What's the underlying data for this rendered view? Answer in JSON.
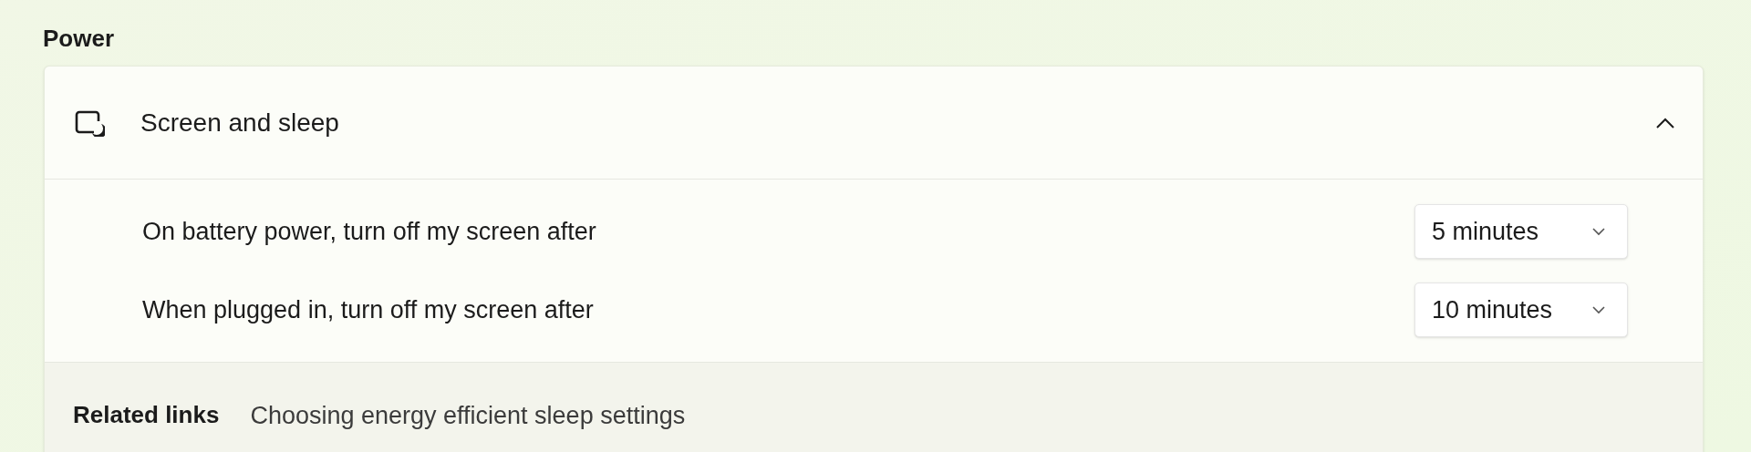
{
  "section_title": "Power",
  "group": {
    "title": "Screen and sleep",
    "expanded": true,
    "settings": [
      {
        "label": "On battery power, turn off my screen after",
        "value": "5 minutes"
      },
      {
        "label": "When plugged in, turn off my screen after",
        "value": "10 minutes"
      }
    ]
  },
  "related": {
    "heading": "Related links",
    "links": [
      "Choosing energy efficient sleep settings"
    ]
  }
}
